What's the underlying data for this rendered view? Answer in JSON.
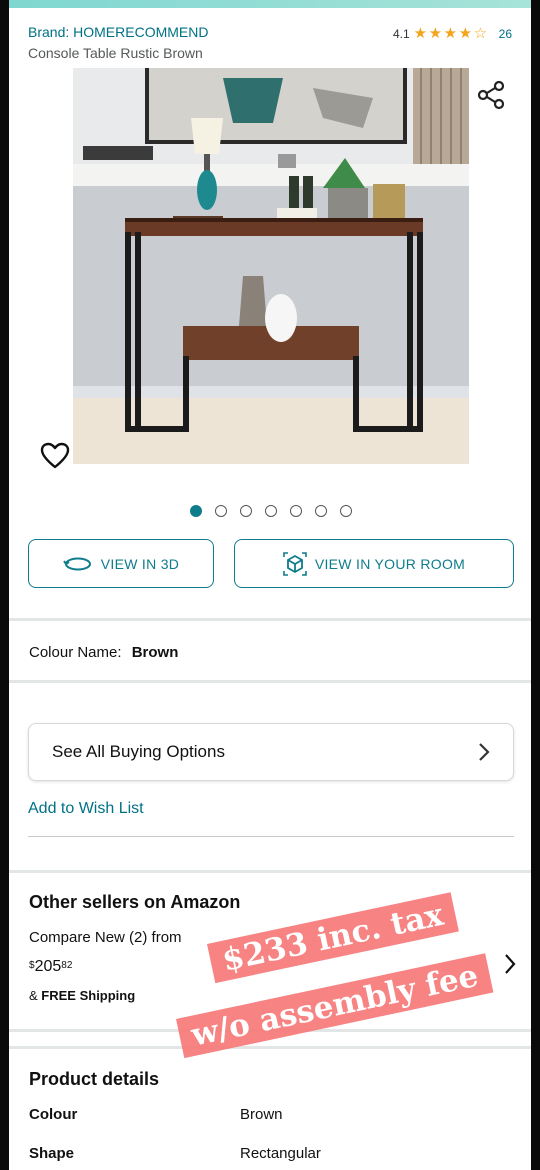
{
  "product": {
    "brand": "Brand: HOMERECOMMEND",
    "title": "Console Table Rustic Brown",
    "rating": "4.1",
    "rating_stars": 4.1,
    "review_count": "26"
  },
  "gallery": {
    "image_count": 7,
    "active_index": 0
  },
  "actions": {
    "view_3d": "VIEW IN 3D",
    "view_room": "VIEW IN YOUR ROOM"
  },
  "colour": {
    "label": "Colour Name:",
    "value": "Brown"
  },
  "buying": {
    "see_all": "See All Buying Options",
    "wish_list": "Add to Wish List"
  },
  "other_sellers": {
    "title": "Other sellers on Amazon",
    "compare": "Compare New (2) from",
    "currency": "$",
    "price_whole": "205",
    "price_cents": "82",
    "shipping_prefix": "&",
    "shipping": "FREE Shipping"
  },
  "overlay": {
    "line1": "$233 inc. tax",
    "line2": "w/o assembly fee"
  },
  "product_details": {
    "title": "Product details",
    "rows": [
      {
        "key": "Colour",
        "value": "Brown"
      },
      {
        "key": "Shape",
        "value": "Rectangular"
      }
    ]
  },
  "colors": {
    "link": "#007185",
    "accent": "#0f7c8c",
    "star": "#f4a41d",
    "overlay": "#f67878"
  }
}
